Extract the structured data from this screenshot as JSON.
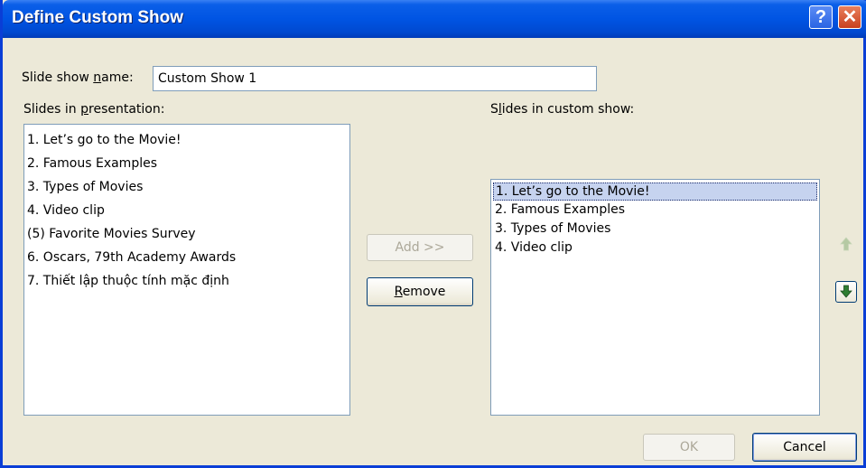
{
  "window": {
    "title": "Define Custom Show",
    "help_glyph": "?",
    "close_glyph": "✕"
  },
  "name_field": {
    "label_prefix": "Slide show ",
    "label_underlined": "n",
    "label_suffix": "ame:",
    "value": "Custom Show 1"
  },
  "left_panel": {
    "label_prefix": "Slides in ",
    "label_underlined": "p",
    "label_suffix": "resentation:",
    "items": [
      "1. Let’s go to the Movie!",
      "2. Famous Examples",
      "3. Types of Movies",
      "4. Video clip",
      "(5) Favorite Movies Survey",
      "6. Oscars, 79th Academy Awards",
      "7. Thiết lập thuộc tính mặc định"
    ]
  },
  "right_panel": {
    "label_prefix": "S",
    "label_underlined": "l",
    "label_suffix": "ides in custom show:",
    "items": [
      "1. Let’s go to the Movie!",
      "2. Famous Examples",
      "3. Types of Movies",
      "4. Video clip"
    ],
    "selected_index": 0
  },
  "buttons": {
    "add": "Add >>",
    "remove_underlined": "R",
    "remove_rest": "emove",
    "ok": "OK",
    "cancel": "Cancel"
  },
  "icons": {
    "up": "arrow-up-icon",
    "down": "arrow-down-icon"
  },
  "colors": {
    "titlebar": "#0054e3",
    "selection": "#c6d3ef",
    "arrow_green": "#2e7d32",
    "arrow_disabled": "#b5c9a3"
  }
}
